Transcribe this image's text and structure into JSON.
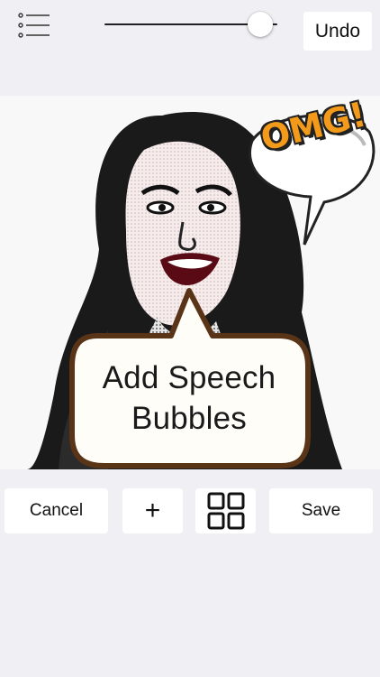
{
  "toolbar": {
    "menu_icon": "list-icon",
    "slider_value": 0.9,
    "undo_label": "Undo"
  },
  "canvas": {
    "sticker_text": "OMG!",
    "bubble_line1": "Add Speech",
    "bubble_line2": "Bubbles"
  },
  "actions": {
    "cancel_label": "Cancel",
    "add_label": "+",
    "grid_icon": "grid-icon",
    "save_label": "Save"
  },
  "colors": {
    "background": "#efeff4",
    "omg_orange": "#f39a1a",
    "bubble_border": "#5a3416"
  }
}
